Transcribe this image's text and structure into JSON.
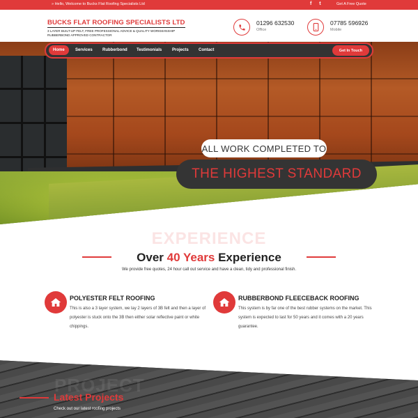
{
  "topbar": {
    "welcome": "»  Hello, Welcome to Bucks Flat Roofing Specialists Ltd",
    "quote": "Get A Free Quote",
    "social": [
      "f",
      "t"
    ]
  },
  "brand": {
    "name": "BUCKS FLAT ROOFING SPECIALISTS LTD",
    "tagline1": "3 LAYER BUILT-UP FELT, FREE PROFESSIONAL ADVICE & QUALITY WORKMANSHIP",
    "tagline2": "RUBBERBOND APPROVED CONTRACTOR"
  },
  "contacts": [
    {
      "number": "01296 632530",
      "label": "Office",
      "icon": "phone-icon"
    },
    {
      "number": "07785 596926",
      "label": "Mobile",
      "icon": "mobile-icon"
    }
  ],
  "nav": {
    "items": [
      "Home",
      "Services",
      "Rubberbond",
      "Testimonials",
      "Projects",
      "Contact"
    ],
    "active": "Home",
    "cta": "Get In Touch"
  },
  "hero": {
    "line1": "ALL WORK COMPLETED TO",
    "line2": "THE HIGHEST STANDARD"
  },
  "experience": {
    "watermark": "EXPERIENCE",
    "title_pre": "Over ",
    "title_highlight": "40 Years",
    "title_post": " Experience",
    "subtitle": "We provide free quotes, 24 hour call out service and have a clean, tidy and professional finish."
  },
  "features": [
    {
      "title": "POLYESTER FELT ROOFING",
      "text": "This is also a 3 layer system, we lay 2 layers of 3B felt and then a layer of polyester is stuck onto the 3B then either solar reflective paint or white chippings.",
      "icon": "home-icon"
    },
    {
      "title": "RUBBERBOND FLEECEBACK ROOFING",
      "text": "This system is by far one of the best rubber systems on the market. This system is expected to last for 50 years and it comes with a 20 years guarantee.",
      "icon": "home-icon"
    }
  ],
  "projects": {
    "watermark": "PROJECT",
    "title": "Latest Projects",
    "subtitle": "Check out our latest roofing projects"
  },
  "colors": {
    "accent": "#e03a3a",
    "dark": "#333333"
  }
}
